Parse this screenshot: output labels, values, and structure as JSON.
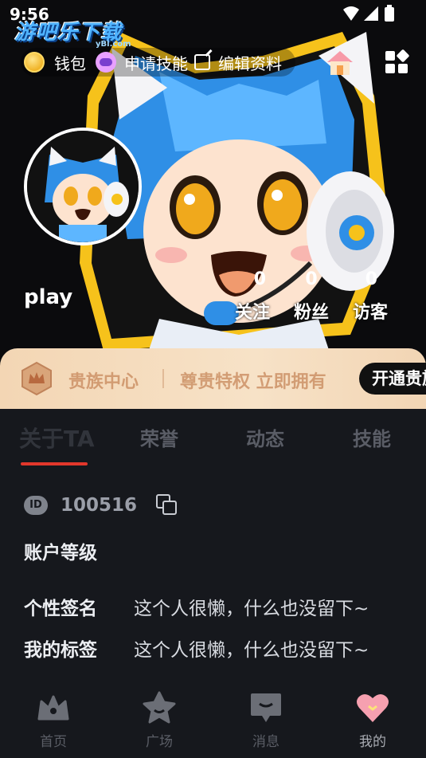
{
  "status": {
    "time": "9:56"
  },
  "watermark": {
    "brand": "游吧乐下载",
    "domain": "yBl.com"
  },
  "topbar": {
    "wallet_label": "钱包",
    "apply_skill_label": "申请技能",
    "edit_profile_label": "编辑资料"
  },
  "profile": {
    "username": "play",
    "stats": [
      {
        "value": "0",
        "label": "关注"
      },
      {
        "value": "0",
        "label": "粉丝"
      },
      {
        "value": "0",
        "label": "访客"
      }
    ]
  },
  "vip": {
    "title": "贵族中心",
    "description": "尊贵特权 立即拥有",
    "button_label": "开通贵族"
  },
  "tabs": [
    {
      "label": "关于TA",
      "active": true
    },
    {
      "label": "荣誉",
      "active": false
    },
    {
      "label": "动态",
      "active": false
    },
    {
      "label": "技能",
      "active": false
    }
  ],
  "about": {
    "id_badge": "ID",
    "id_value": "100516",
    "level_label": "账户等级",
    "signature_label": "个性签名",
    "signature_value": "这个人很懒，什么也没留下~",
    "tags_label": "我的标签",
    "tags_value": "这个人很懒，什么也没留下~"
  },
  "bottom_nav": [
    {
      "label": "首页",
      "icon": "crown-icon",
      "active": false
    },
    {
      "label": "广场",
      "icon": "star-icon",
      "active": false
    },
    {
      "label": "消息",
      "icon": "message-icon",
      "active": false
    },
    {
      "label": "我的",
      "icon": "heart-icon",
      "active": true
    }
  ],
  "colors": {
    "background": "#16181d",
    "accent_red": "#e2372b",
    "vip_gold": "#c7875a",
    "avatar_blue": "#2f8fe6"
  }
}
